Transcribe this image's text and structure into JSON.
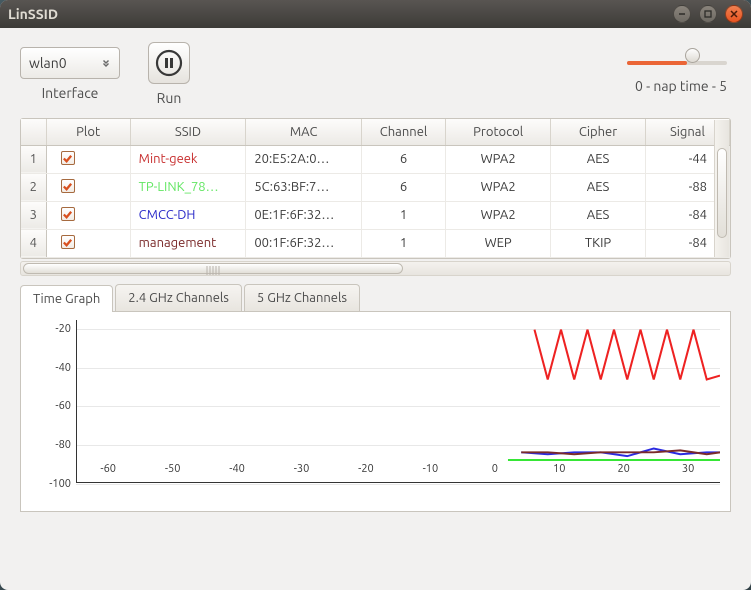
{
  "window": {
    "title": "LinSSID"
  },
  "toolbar": {
    "interface_label": "Interface",
    "interface_value": "wlan0",
    "run_label": "Run",
    "nap_label": "0 - nap time - 5"
  },
  "table": {
    "headers": [
      "",
      "Plot",
      "SSID",
      "MAC",
      "Channel",
      "Protocol",
      "Cipher",
      "Signal"
    ],
    "rows": [
      {
        "n": "1",
        "ssid": "Mint-geek",
        "color": "#c83030",
        "mac": "20:E5:2A:0…",
        "channel": "6",
        "protocol": "WPA2",
        "cipher": "AES",
        "signal": "-44"
      },
      {
        "n": "2",
        "ssid": "TP-LINK_78…",
        "color": "#63e663",
        "mac": "5C:63:BF:7…",
        "channel": "6",
        "protocol": "WPA2",
        "cipher": "AES",
        "signal": "-88"
      },
      {
        "n": "3",
        "ssid": "CMCC-DH",
        "color": "#2a2ac8",
        "mac": "0E:1F:6F:32…",
        "channel": "1",
        "protocol": "WPA2",
        "cipher": "AES",
        "signal": "-84"
      },
      {
        "n": "4",
        "ssid": "management",
        "color": "#7a2a2a",
        "mac": "00:1F:6F:32…",
        "channel": "1",
        "protocol": "WEP",
        "cipher": "TKIP",
        "signal": "-84"
      }
    ]
  },
  "tabs": {
    "items": [
      "Time Graph",
      "2.4 GHz Channels",
      "5 GHz Channels"
    ],
    "active": 0
  },
  "chart_data": {
    "type": "line",
    "title": "",
    "xlabel": "",
    "ylabel": "",
    "xlim": [
      -65,
      32
    ],
    "ylim": [
      -100,
      -15
    ],
    "xticks": [
      -60,
      -50,
      -40,
      -30,
      -20,
      -10,
      0,
      10,
      20,
      30
    ],
    "yticks": [
      -20,
      -40,
      -60,
      -80,
      -100
    ],
    "series": [
      {
        "name": "Mint-geek",
        "color": "#ee2222",
        "x": [
          4,
          6,
          8,
          10,
          12,
          14,
          16,
          18,
          20,
          22,
          24,
          26,
          28,
          30,
          32
        ],
        "y": [
          -20,
          -46,
          -20,
          -46,
          -20,
          -46,
          -20,
          -46,
          -20,
          -46,
          -20,
          -46,
          -20,
          -46,
          -44
        ]
      },
      {
        "name": "TP-LINK_78",
        "color": "#36e636",
        "x": [
          0,
          5,
          10,
          15,
          20,
          25,
          30,
          32
        ],
        "y": [
          -88,
          -88,
          -88,
          -88,
          -88,
          -88,
          -88,
          -88
        ]
      },
      {
        "name": "CMCC-DH",
        "color": "#2a2ae0",
        "x": [
          2,
          6,
          10,
          14,
          18,
          22,
          26,
          30,
          32
        ],
        "y": [
          -84,
          -85,
          -84,
          -84,
          -86,
          -82,
          -85,
          -84,
          -84
        ]
      },
      {
        "name": "management",
        "color": "#7a2a2a",
        "x": [
          2,
          6,
          10,
          14,
          18,
          22,
          26,
          30,
          32
        ],
        "y": [
          -84,
          -84,
          -85,
          -84,
          -84,
          -84,
          -83,
          -85,
          -84
        ]
      }
    ]
  }
}
